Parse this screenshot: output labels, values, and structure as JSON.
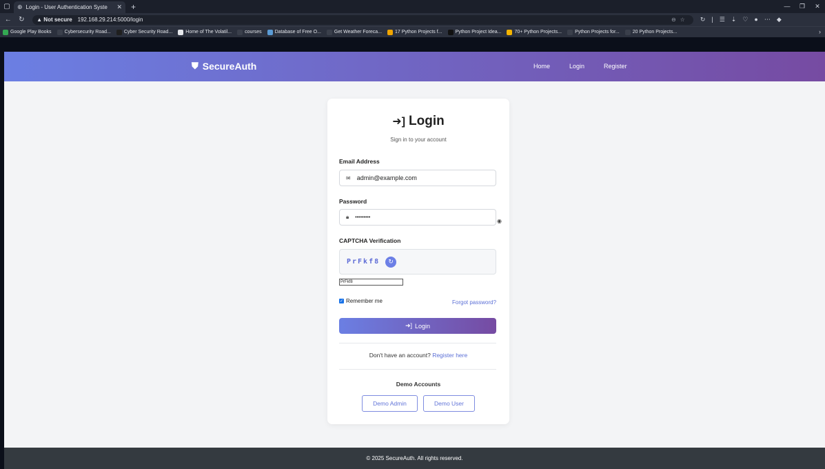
{
  "browser": {
    "tab_title": "Login - User Authentication Syste",
    "security_label": "Not secure",
    "url": "192.168.29.214:5000/login",
    "bookmarks": [
      {
        "label": "Google Play Books",
        "color": "#34a853"
      },
      {
        "label": "Cybersecurity Road...",
        "color": "#3a3f4b"
      },
      {
        "label": "Cyber Security Road...",
        "color": "#1f1f1f"
      },
      {
        "label": "Home of The Volatil...",
        "color": "#e5e7eb"
      },
      {
        "label": "courses",
        "color": "#3a3f4b"
      },
      {
        "label": "Database of Free O...",
        "color": "#5b9bd5"
      },
      {
        "label": "Get Weather Foreca...",
        "color": "#3a3f4b"
      },
      {
        "label": "17 Python Projects f...",
        "color": "#f0a500"
      },
      {
        "label": "Python Project Idea...",
        "color": "#111111"
      },
      {
        "label": "70+ Python Projects...",
        "color": "#f4b400"
      },
      {
        "label": "Python Projects for...",
        "color": "#3a3f4b"
      },
      {
        "label": "20 Python Projects...",
        "color": "#3a3f4b"
      }
    ]
  },
  "navbar": {
    "brand": "SecureAuth",
    "links": [
      "Home",
      "Login",
      "Register"
    ]
  },
  "login": {
    "title": "Login",
    "subtitle": "Sign in to your account",
    "email_label": "Email Address",
    "email_value": "admin@example.com",
    "password_label": "Password",
    "password_value": "•••••••••",
    "captcha_label": "CAPTCHA Verification",
    "captcha_code": "PrFkf8",
    "captcha_input": "PrFkf8",
    "remember_label": "Remember me",
    "forgot_label": "Forgot password?",
    "submit_label": "Login",
    "no_account_text": "Don't have an account?",
    "register_link": "Register here",
    "demo_title": "Demo Accounts",
    "demo_admin": "Demo Admin",
    "demo_user": "Demo User"
  },
  "footer": {
    "text": "© 2025 SecureAuth. All rights reserved."
  },
  "colors": {
    "gradient_start": "#6b7fe3",
    "gradient_end": "#764ba2",
    "link": "#5b6fd6",
    "footer_bg": "#343a40"
  }
}
